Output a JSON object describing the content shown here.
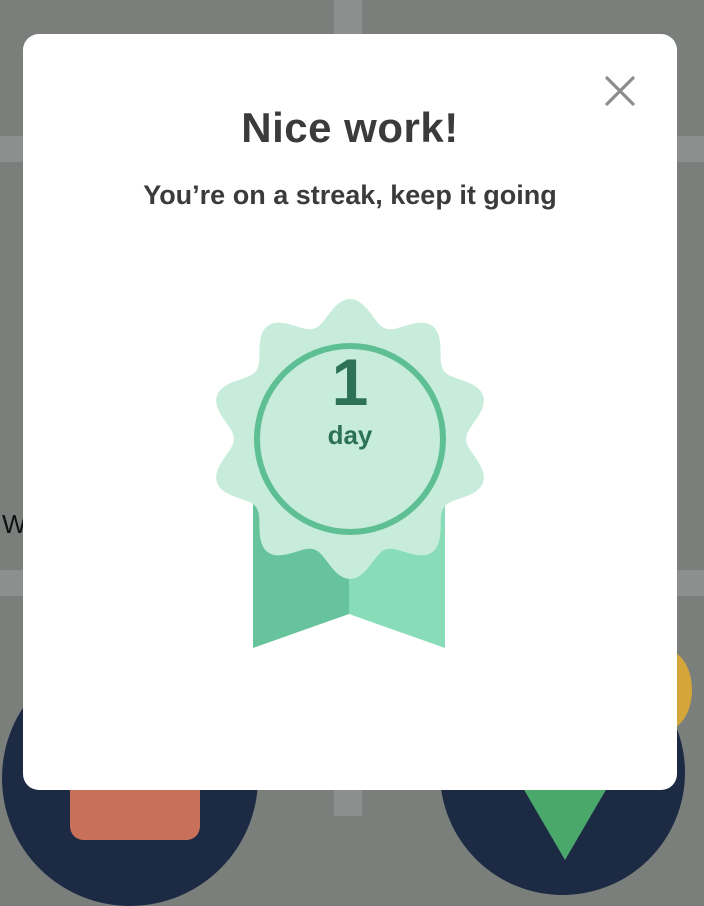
{
  "background": {
    "fragment_text": "W"
  },
  "modal": {
    "title": "Nice work!",
    "subtitle": "You’re on a streak, keep it going",
    "close_icon": "close-icon",
    "badge": {
      "icon": "streak-rosette-badge",
      "count": "1",
      "unit": "day"
    }
  },
  "colors": {
    "badge_light": "#c8ecdc",
    "badge_ring": "#5fbf94",
    "ribbon_dark": "#66c39b",
    "ribbon_light": "#88ddb8",
    "badge_text": "#2d7258",
    "text_dark": "#3b3b3b",
    "close_icon": "#8c8c8c"
  }
}
